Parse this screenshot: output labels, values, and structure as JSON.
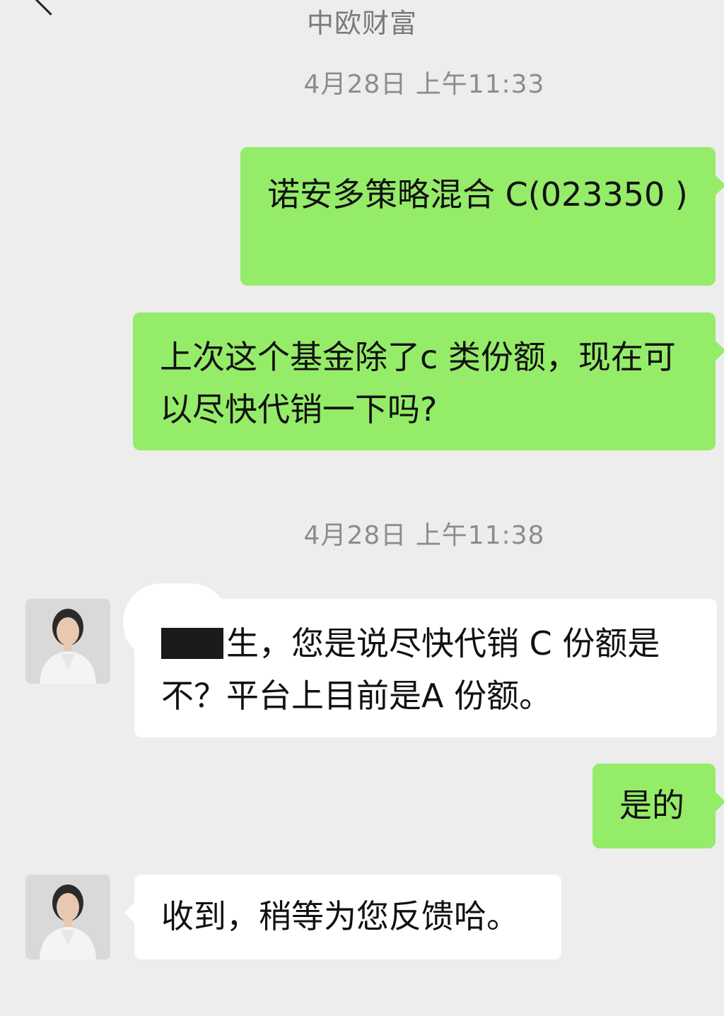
{
  "header": {
    "title": "中欧财富"
  },
  "messages": [
    {
      "type": "time",
      "text": "4月28日 上午11:33"
    },
    {
      "type": "out",
      "text": "诺安多策略混合 C(023350 )"
    },
    {
      "type": "out",
      "text": "上次这个基金除了c 类份额，现在可以尽快代销一下吗?"
    },
    {
      "type": "time",
      "text": "4月28日 上午11:38"
    },
    {
      "type": "in",
      "text": "生，您是说尽快代销 C 份额是不？平台上目前是A 份额。"
    },
    {
      "type": "out",
      "text": "是的"
    },
    {
      "type": "in",
      "text": "收到，稍等为您反馈哈。"
    }
  ],
  "colors": {
    "background": "#ededed",
    "outgoing_bubble": "#95ec69",
    "incoming_bubble": "#ffffff",
    "timestamp_text": "#8c8c8c"
  }
}
